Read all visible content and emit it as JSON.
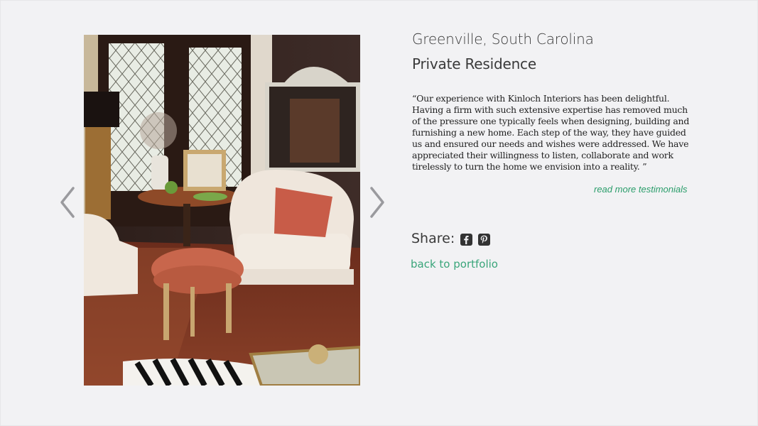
{
  "gallery": {
    "prev_icon": "chevron-left-icon",
    "next_icon": "chevron-right-icon",
    "photo_icon": "interior-photo"
  },
  "project": {
    "location": "Greenville, South Carolina",
    "type": "Private Residence"
  },
  "testimonial": {
    "quote": "“Our experience with Kinloch Interiors has been delightful. Having a firm with such extensive expertise has removed much of the pressure one typically feels when designing, building and furnishing a new home.  Each step of the way, they have guided us and ensured our needs and wishes were addressed. We have appreciated their willingness to listen, collaborate and work tirelessly to turn the home we envision into a reality. ”",
    "read_more": "read more testimonials"
  },
  "share": {
    "label": "Share:",
    "icons": [
      "facebook-icon",
      "pinterest-icon"
    ]
  },
  "navigation": {
    "back_label": "back to portfolio"
  },
  "colors": {
    "background": "#f2f2f4",
    "accent_green": "#2a9d6a",
    "text_dark": "#3a3a3a"
  }
}
